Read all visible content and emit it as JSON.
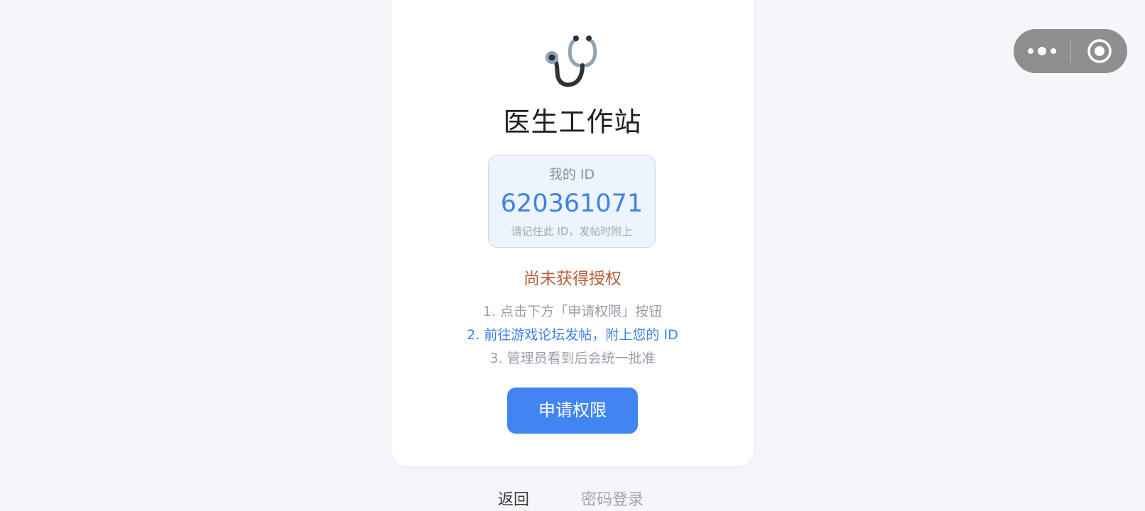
{
  "app": {
    "title": "医生工作站",
    "logo_icon": "stethoscope-icon"
  },
  "id_card": {
    "label": "我的 ID",
    "value": "620361071",
    "hint": "请记住此 ID，发帖时附上"
  },
  "authorization": {
    "status": "尚未获得授权",
    "steps": [
      "1. 点击下方「申请权限」按钮",
      "2. 前往游戏论坛发帖，附上您的 ID",
      "3. 管理员看到后会统一批准"
    ],
    "highlighted_step_index": 1
  },
  "actions": {
    "apply_label": "申请权限",
    "back_label": "返回",
    "password_login_label": "密码登录"
  },
  "miniprogram_capsule": {
    "more_icon": "more-dots-icon",
    "close_icon": "target-circle-icon"
  },
  "colors": {
    "background": "#f5f6fa",
    "accent": "#4185f3",
    "id_value": "#3e82e6",
    "status_warning": "#b0603a",
    "capsule": "#8e8e8e"
  }
}
